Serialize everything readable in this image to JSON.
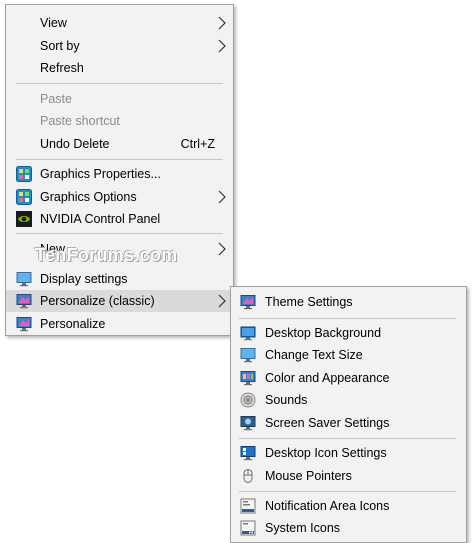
{
  "main_menu": {
    "view": "View",
    "sort_by": "Sort by",
    "refresh": "Refresh",
    "paste": "Paste",
    "paste_shortcut": "Paste shortcut",
    "undo_delete": "Undo Delete",
    "undo_delete_shortcut": "Ctrl+Z",
    "graphics_properties": "Graphics Properties...",
    "graphics_options": "Graphics Options",
    "nvidia_control_panel": "NVIDIA Control Panel",
    "new": "New",
    "display_settings": "Display settings",
    "personalize_classic": "Personalize (classic)",
    "personalize": "Personalize"
  },
  "sub_menu": {
    "theme_settings": "Theme Settings",
    "desktop_background": "Desktop Background",
    "change_text_size": "Change Text Size",
    "color_and_appearance": "Color and Appearance",
    "sounds": "Sounds",
    "screen_saver_settings": "Screen Saver Settings",
    "desktop_icon_settings": "Desktop Icon Settings",
    "mouse_pointers": "Mouse Pointers",
    "notification_area_icons": "Notification Area Icons",
    "system_icons": "System Icons"
  },
  "watermark": "TenForums.com",
  "colors": {
    "menu_bg": "#f2f2f2",
    "highlight": "#dadada",
    "disabled_text": "#8c8c8c",
    "separator": "#c6c6c6"
  },
  "icons": {
    "graphics_properties": "intel-graphics-icon",
    "graphics_options": "intel-graphics-icon",
    "nvidia_control_panel": "nvidia-icon",
    "display_settings": "monitor-icon",
    "personalize_classic": "personalize-monitor-icon",
    "personalize": "personalize-monitor-icon"
  }
}
